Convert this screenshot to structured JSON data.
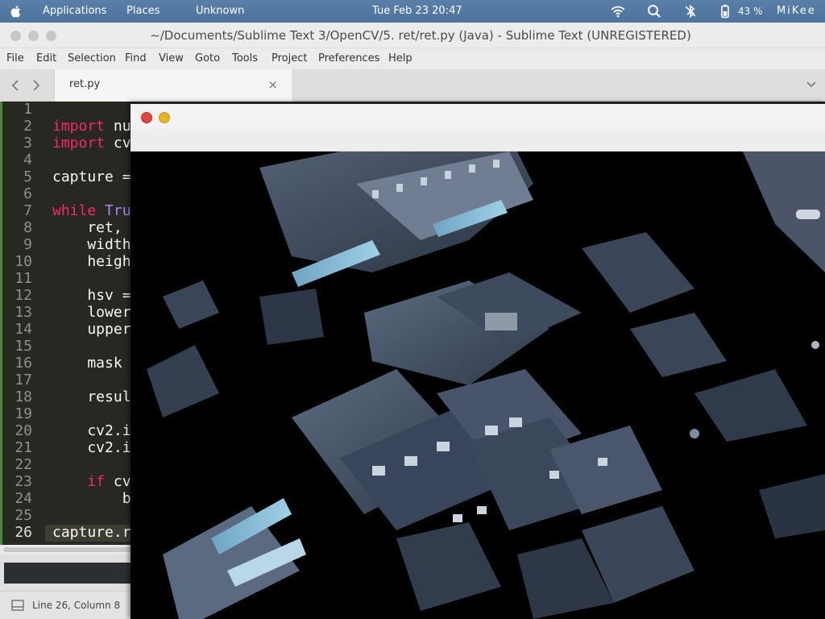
{
  "panel": {
    "applications": "Applications",
    "places": "Places",
    "unknown": "Unknown",
    "datetime": "Tue Feb 23  20:47",
    "battery": "43 %",
    "user": "MiKee",
    "icons": [
      "apple-icon",
      "wifi-icon",
      "search-icon",
      "bluetooth-icon",
      "battery-icon"
    ]
  },
  "window": {
    "title": "~/Documents/Sublime Text 3/OpenCV/5. ret/ret.py (Java) - Sublime Text (UNREGISTERED)"
  },
  "menu": [
    "File",
    "Edit",
    "Selection",
    "Find",
    "View",
    "Goto",
    "Tools",
    "Project",
    "Preferences",
    "Help"
  ],
  "tab": {
    "label": "ret.py",
    "close": "×"
  },
  "editor": {
    "line_numbers": [
      "1",
      "2",
      "3",
      "4",
      "5",
      "6",
      "7",
      "8",
      "9",
      "10",
      "11",
      "12",
      "13",
      "14",
      "15",
      "16",
      "17",
      "18",
      "19",
      "20",
      "21",
      "22",
      "23",
      "24",
      "25",
      "26"
    ],
    "current_line": "26",
    "visible_code": {
      "l2a": "import",
      "l2b": " nu",
      "l3a": "import",
      "l3b": " cv",
      "l5": "capture =",
      "l7a": "while",
      "l7b": " Tru",
      "l8": "    ret,",
      "l9": "    width",
      "l10": "    heigh",
      "l12": "    hsv =",
      "l13": "    lower",
      "l14": "    upper",
      "l16": "    mask",
      "l18": "    resul",
      "l20": "    cv2.i",
      "l21": "    cv2.i",
      "l23a": "    if",
      "l23b": " cv",
      "l24": "        b",
      "l26": "capture.r"
    }
  },
  "statusbar": {
    "text": "Line 26, Column 8"
  },
  "colors": {
    "panel": "#4d739c",
    "editor_bg": "#272822",
    "keyword": "#f92672",
    "close_dot": "#e0443e",
    "minimize_dot": "#e8b422"
  }
}
